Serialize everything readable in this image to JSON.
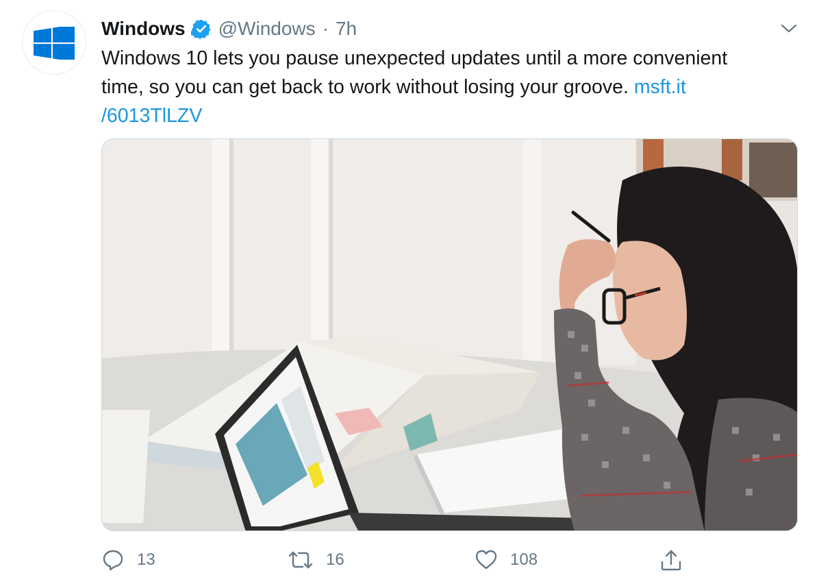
{
  "tweet": {
    "author": {
      "display_name": "Windows",
      "handle": "@Windows",
      "verified": true,
      "avatar_icon": "windows-logo-icon"
    },
    "separator": "·",
    "time": "7h",
    "text_lines": [
      "Windows 10 lets you pause unexpected updates until a more convenient",
      "time, so you can get back to work without losing your groove."
    ],
    "link_part1": "msft.it",
    "link_part2": "/6013TlLZV",
    "media_icon": "photo-woman-with-laptop"
  },
  "actions": {
    "reply": {
      "icon": "reply-icon",
      "count": "13"
    },
    "retweet": {
      "icon": "retweet-icon",
      "count": "16"
    },
    "like": {
      "icon": "heart-icon",
      "count": "108"
    },
    "share": {
      "icon": "share-icon"
    }
  },
  "colors": {
    "brand_blue": "#1da1f2",
    "link_blue": "#1b95e0",
    "windows_blue": "#0078d7",
    "text_secondary": "#657786",
    "text_primary": "#14171a"
  }
}
